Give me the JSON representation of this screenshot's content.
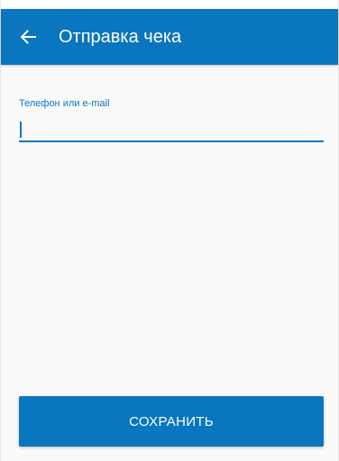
{
  "app_bar": {
    "title": "Отправка чека",
    "back_icon": "arrow-back-icon",
    "background": "#0a76bf",
    "title_color": "#ffffff"
  },
  "form": {
    "contact_field": {
      "label": "Телефон или e-mail",
      "value": "",
      "accent_color": "#0a76bf"
    }
  },
  "actions": {
    "save_label": "СОХРАНИТЬ",
    "button_color": "#0a76bf"
  }
}
